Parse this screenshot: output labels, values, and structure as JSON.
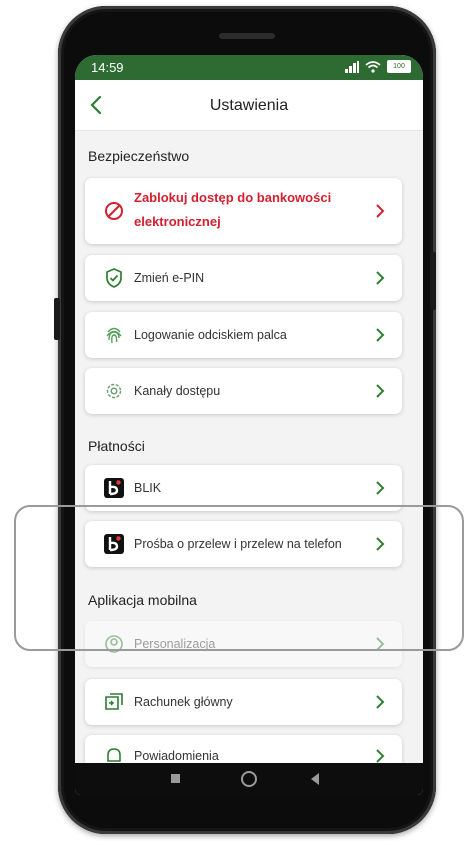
{
  "status_bar": {
    "time": "14:59",
    "battery": "100"
  },
  "header": {
    "title": "Ustawienia"
  },
  "sections": {
    "security": {
      "title": "Bezpieczeństwo",
      "items": [
        {
          "label_line1": "Zablokuj dostęp do bankowości",
          "label_line2": "elektronicznej",
          "icon": "block-icon"
        },
        {
          "label": "Zmień e-PIN",
          "icon": "shield-check-icon"
        },
        {
          "label": "Logowanie odciskiem palca",
          "icon": "fingerprint-icon"
        },
        {
          "label": "Kanały dostępu",
          "icon": "gear-icon"
        }
      ]
    },
    "payments": {
      "title": "Płatności",
      "items": [
        {
          "label": "BLIK",
          "icon": "blik-icon"
        },
        {
          "label": "Prośba o przelew i przelew na telefon",
          "icon": "blik-icon"
        }
      ]
    },
    "mobile_app": {
      "title": "Aplikacja mobilna",
      "items": [
        {
          "label": "Personalizacja",
          "icon": "personalize-icon"
        },
        {
          "label": "Rachunek główny",
          "icon": "account-icon"
        },
        {
          "label": "Powiadomienia",
          "icon": "bell-icon"
        }
      ]
    }
  },
  "colors": {
    "accent": "#2e6b33",
    "danger": "#d3202f",
    "icon_green": "#2e7d32"
  }
}
